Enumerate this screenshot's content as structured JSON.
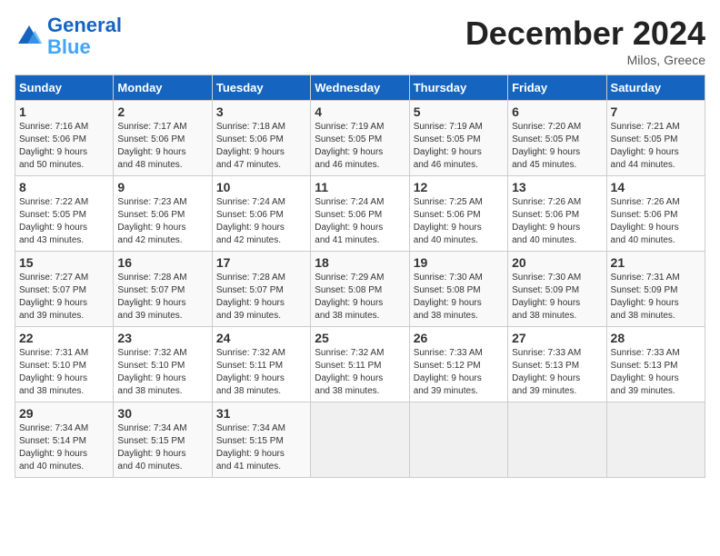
{
  "header": {
    "logo_line1": "General",
    "logo_line2": "Blue",
    "month": "December 2024",
    "location": "Milos, Greece"
  },
  "weekdays": [
    "Sunday",
    "Monday",
    "Tuesday",
    "Wednesday",
    "Thursday",
    "Friday",
    "Saturday"
  ],
  "weeks": [
    [
      {
        "day": "1",
        "info": "Sunrise: 7:16 AM\nSunset: 5:06 PM\nDaylight: 9 hours\nand 50 minutes."
      },
      {
        "day": "2",
        "info": "Sunrise: 7:17 AM\nSunset: 5:06 PM\nDaylight: 9 hours\nand 48 minutes."
      },
      {
        "day": "3",
        "info": "Sunrise: 7:18 AM\nSunset: 5:06 PM\nDaylight: 9 hours\nand 47 minutes."
      },
      {
        "day": "4",
        "info": "Sunrise: 7:19 AM\nSunset: 5:05 PM\nDaylight: 9 hours\nand 46 minutes."
      },
      {
        "day": "5",
        "info": "Sunrise: 7:19 AM\nSunset: 5:05 PM\nDaylight: 9 hours\nand 46 minutes."
      },
      {
        "day": "6",
        "info": "Sunrise: 7:20 AM\nSunset: 5:05 PM\nDaylight: 9 hours\nand 45 minutes."
      },
      {
        "day": "7",
        "info": "Sunrise: 7:21 AM\nSunset: 5:05 PM\nDaylight: 9 hours\nand 44 minutes."
      }
    ],
    [
      {
        "day": "8",
        "info": "Sunrise: 7:22 AM\nSunset: 5:05 PM\nDaylight: 9 hours\nand 43 minutes."
      },
      {
        "day": "9",
        "info": "Sunrise: 7:23 AM\nSunset: 5:06 PM\nDaylight: 9 hours\nand 42 minutes."
      },
      {
        "day": "10",
        "info": "Sunrise: 7:24 AM\nSunset: 5:06 PM\nDaylight: 9 hours\nand 42 minutes."
      },
      {
        "day": "11",
        "info": "Sunrise: 7:24 AM\nSunset: 5:06 PM\nDaylight: 9 hours\nand 41 minutes."
      },
      {
        "day": "12",
        "info": "Sunrise: 7:25 AM\nSunset: 5:06 PM\nDaylight: 9 hours\nand 40 minutes."
      },
      {
        "day": "13",
        "info": "Sunrise: 7:26 AM\nSunset: 5:06 PM\nDaylight: 9 hours\nand 40 minutes."
      },
      {
        "day": "14",
        "info": "Sunrise: 7:26 AM\nSunset: 5:06 PM\nDaylight: 9 hours\nand 40 minutes."
      }
    ],
    [
      {
        "day": "15",
        "info": "Sunrise: 7:27 AM\nSunset: 5:07 PM\nDaylight: 9 hours\nand 39 minutes."
      },
      {
        "day": "16",
        "info": "Sunrise: 7:28 AM\nSunset: 5:07 PM\nDaylight: 9 hours\nand 39 minutes."
      },
      {
        "day": "17",
        "info": "Sunrise: 7:28 AM\nSunset: 5:07 PM\nDaylight: 9 hours\nand 39 minutes."
      },
      {
        "day": "18",
        "info": "Sunrise: 7:29 AM\nSunset: 5:08 PM\nDaylight: 9 hours\nand 38 minutes."
      },
      {
        "day": "19",
        "info": "Sunrise: 7:30 AM\nSunset: 5:08 PM\nDaylight: 9 hours\nand 38 minutes."
      },
      {
        "day": "20",
        "info": "Sunrise: 7:30 AM\nSunset: 5:09 PM\nDaylight: 9 hours\nand 38 minutes."
      },
      {
        "day": "21",
        "info": "Sunrise: 7:31 AM\nSunset: 5:09 PM\nDaylight: 9 hours\nand 38 minutes."
      }
    ],
    [
      {
        "day": "22",
        "info": "Sunrise: 7:31 AM\nSunset: 5:10 PM\nDaylight: 9 hours\nand 38 minutes."
      },
      {
        "day": "23",
        "info": "Sunrise: 7:32 AM\nSunset: 5:10 PM\nDaylight: 9 hours\nand 38 minutes."
      },
      {
        "day": "24",
        "info": "Sunrise: 7:32 AM\nSunset: 5:11 PM\nDaylight: 9 hours\nand 38 minutes."
      },
      {
        "day": "25",
        "info": "Sunrise: 7:32 AM\nSunset: 5:11 PM\nDaylight: 9 hours\nand 38 minutes."
      },
      {
        "day": "26",
        "info": "Sunrise: 7:33 AM\nSunset: 5:12 PM\nDaylight: 9 hours\nand 39 minutes."
      },
      {
        "day": "27",
        "info": "Sunrise: 7:33 AM\nSunset: 5:13 PM\nDaylight: 9 hours\nand 39 minutes."
      },
      {
        "day": "28",
        "info": "Sunrise: 7:33 AM\nSunset: 5:13 PM\nDaylight: 9 hours\nand 39 minutes."
      }
    ],
    [
      {
        "day": "29",
        "info": "Sunrise: 7:34 AM\nSunset: 5:14 PM\nDaylight: 9 hours\nand 40 minutes."
      },
      {
        "day": "30",
        "info": "Sunrise: 7:34 AM\nSunset: 5:15 PM\nDaylight: 9 hours\nand 40 minutes."
      },
      {
        "day": "31",
        "info": "Sunrise: 7:34 AM\nSunset: 5:15 PM\nDaylight: 9 hours\nand 41 minutes."
      },
      {
        "day": "",
        "info": ""
      },
      {
        "day": "",
        "info": ""
      },
      {
        "day": "",
        "info": ""
      },
      {
        "day": "",
        "info": ""
      }
    ]
  ]
}
